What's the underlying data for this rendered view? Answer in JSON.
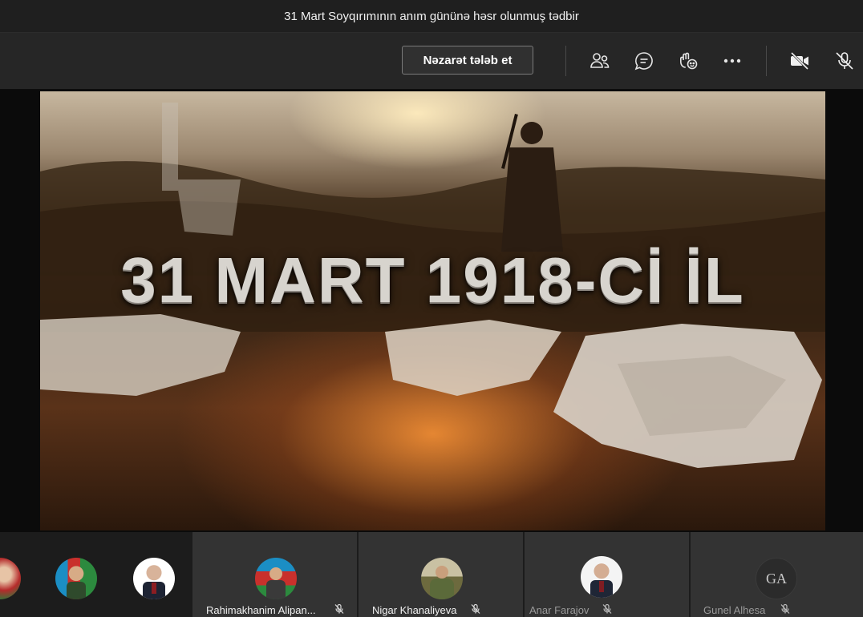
{
  "window": {
    "title": "31 Mart Soyqırımının anım gününə həsr olunmuş tədbir"
  },
  "toolbar": {
    "control_request_label": "Nəzarət tələb et",
    "icons": [
      "participants-icon",
      "chat-icon",
      "reactions-icon",
      "more-options-icon",
      "camera-off-icon",
      "mic-off-icon"
    ]
  },
  "stage": {
    "video_caption": "31 MART 1918-Cİ İL"
  },
  "participants": [
    {
      "name": "",
      "avatar": "photo-flag"
    },
    {
      "name": "",
      "avatar": "photo-officer"
    },
    {
      "name": "",
      "avatar": "photo-suit"
    },
    {
      "name": "Rahimakhanim Alipan...",
      "avatar": "photo-flags",
      "muted": true
    },
    {
      "name": "Nigar Khanaliyeva",
      "avatar": "photo-soldier",
      "muted": true
    },
    {
      "name": "Anar Farajov",
      "avatar": "photo-suit",
      "muted": true
    },
    {
      "name": "Gunel Alhesa",
      "avatar": "initials",
      "initials": "GA",
      "muted": true
    }
  ],
  "colors": {
    "titlebar_bg": "#1f1f1f",
    "toolbar_bg": "#262626",
    "strip_bg": "#1c1c1c",
    "tile_bg": "#333333"
  }
}
